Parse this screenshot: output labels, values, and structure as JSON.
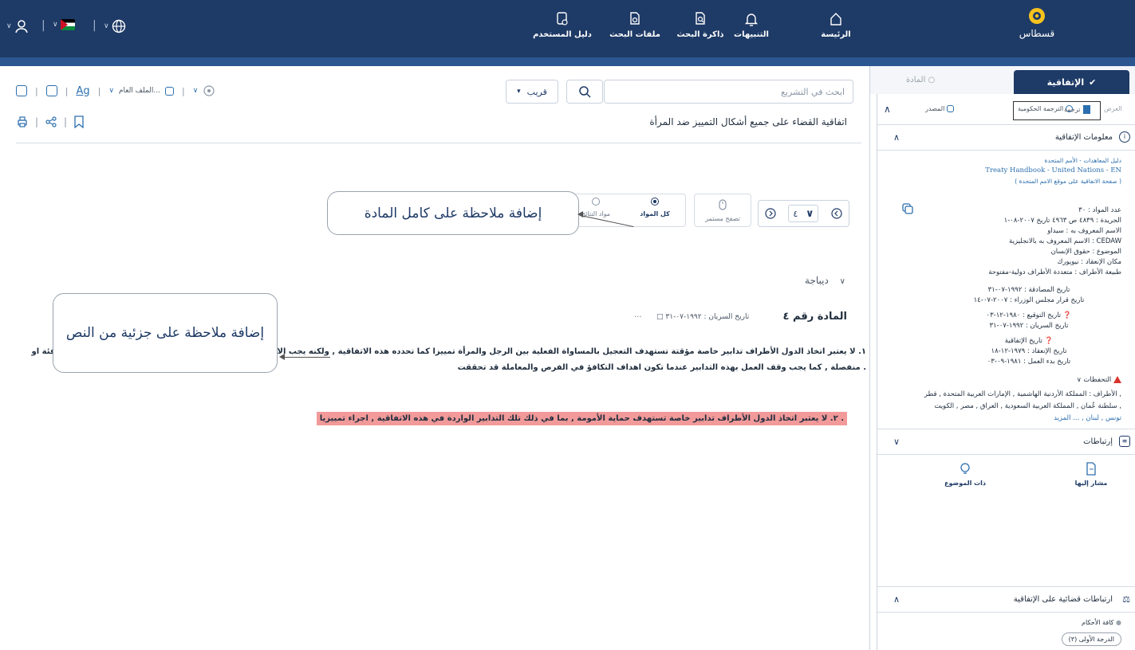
{
  "header": {
    "logo_text": "قسطاس",
    "nav": [
      {
        "label": "الرئيسة",
        "icon": "home-icon"
      },
      {
        "label": "التنبيهات",
        "icon": "bell-icon"
      },
      {
        "label": "ذاكرة البحث",
        "icon": "search-history-icon"
      },
      {
        "label": "ملفات البحث",
        "icon": "search-files-icon"
      },
      {
        "label": "دليل المستخدم",
        "icon": "user-guide-icon"
      }
    ],
    "colors": {
      "bar": "#1e3a66",
      "strip": "#2c5690"
    }
  },
  "toolbar": {
    "search_placeholder": "ابحث في التشريع",
    "near_label": "قريب",
    "file_label": "الملف العام...",
    "font_label": "Ag",
    "doc_title": "اتفاقية القضاء على جميع أشكال التمييز ضد المرأة"
  },
  "article_nav": {
    "number": "٤",
    "browse_label": "تصفح مستمر",
    "all_articles_label": "كل المواد",
    "results_label": "مواد النتائج"
  },
  "content": {
    "preamble": "ديباجة",
    "article_label": "المادة رقم ٤",
    "effective_date": "تاريخ السريان : ١٩٩٢-٠٧-٣١",
    "more": "...",
    "para1": "١. لا يعتبر اتخاذ الدول الأطراف تدابير خاصة مؤقتة تستهدف التعجيل بالمساواة الفعلية بين الرجل والمرأة تمييزا كما تحدده هذه الاتفاقية , ولكنه يجب الا يستتبع بأي حال , كنتيجة له , الابقاء على معايير غير متكافئة او منفصلة , كما يجب وقف العمل بهذه التدابير عندما تكون اهداف التكافؤ في الفرص والمعاملة قد تحققت .",
    "para2": "٢. لا يعتبر اتخاذ الدول الأطراف تدابير خاصة تستهدف حماية الأمومة , بما في ذلك تلك التدابير الواردة في هذه الاتفاقية , اجراء تمييزيا .",
    "highlight_color": "#f29a9a"
  },
  "callouts": {
    "whole_article": "إضافة ملاحظة على كامل المادة",
    "text_part": "إضافة ملاحظة على جزئية من النص"
  },
  "sidebar": {
    "tab_active": "الإتفاقية",
    "tab_inactive": "المادة",
    "sources": {
      "source": "المصدر",
      "gov_translation": "الترجمة الحكومية",
      "translation": "ترجمة",
      "display": "العرض"
    },
    "info_title": "معلومات الإتفاقية",
    "treaty_guide": "دليل المعاهدات - الأمم المتحدة",
    "treaty_handbook": "Treaty Handbook - United Nations - EN",
    "un_page": "( صفحة الاتفاقية على موقع الامم المتحدة )",
    "lines": [
      "عدد المواد : ٣٠",
      "الجريدة : ٤٨٣٩   ص  ٤٩٦٣   تاريخ  ٢٠٠٧-٠٨-١",
      "الاسم المعروف به : سيداو",
      "الاسم المعروف به بالانجليزية : CEDAW",
      "الموضوع : حقوق الإنسان",
      "مكان الإنعقاد : نيويورك",
      "طبيعة الأطراف : متعددة الأطراف دولية-مفتوحة"
    ],
    "dates1": [
      "تاريخ المصادقة : ١٩٩٢-٠٧-٣١",
      "تاريخ قرار مجلس الوزراء : ٢٠٠٧-٠٧-١٤"
    ],
    "dates2": [
      "تاريخ التوقيع : ١٩٨٠-١٢-٠٣",
      "تاريخ السريان : ١٩٩٢-٠٧-٣١"
    ],
    "treaty_dates_title": "تاريخ الإتفاقية",
    "dates3": [
      "تاريخ الإنعقاد : ١٩٧٩-١٢-١٨",
      "تاريخ بدء العمل : ١٩٨١-٠٩-٠٣"
    ],
    "reservations_title": "التحفظات",
    "parties": [
      "الأطراف : المملكة الأردنية الهاشمية , الإمارات العربية المتحدة , قطر ,",
      "سلطنة عُمان , المملكة العربية السعودية , العراق , مصر , الكويت ,",
      "تونس , لبنان , ... المزيد"
    ],
    "links_title": "إرتباطات",
    "referenced": "مشار إليها",
    "same_topic": "ذات الموضوع",
    "judicial_title": "ارتباطات قضائية على الإتفاقية",
    "all_rulings": "كافة الأحكام",
    "first_degree": "الدرجة الأولى (٣)"
  }
}
